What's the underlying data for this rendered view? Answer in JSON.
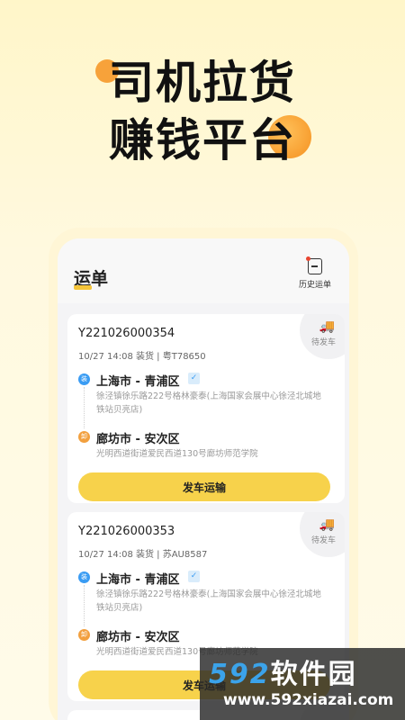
{
  "hero": {
    "line1": "司机拉货",
    "line2": "赚钱平台"
  },
  "header": {
    "title": "运单",
    "history_label": "历史运单",
    "history_icon": "document-icon"
  },
  "orders": [
    {
      "order_no": "Y221026000354",
      "meta": "10/27 14:08 装货 | 粤T78650",
      "status": "待发车",
      "load_badge": "装",
      "load_city": "上海市 - 青浦区",
      "load_address": "徐泾镇徐乐路222号格林豪泰(上海国家会展中心徐泾北城地铁站贝亮店)",
      "unload_badge": "卸",
      "unload_city": "廊坊市 - 安次区",
      "unload_address": "光明西道街道爱民西道130号廊坊师范学院",
      "action_label": "发车运输"
    },
    {
      "order_no": "Y221026000353",
      "meta": "10/27 14:08 装货 | 苏AU8587",
      "status": "待发车",
      "load_badge": "装",
      "load_city": "上海市 - 青浦区",
      "load_address": "徐泾镇徐乐路222号格林豪泰(上海国家会展中心徐泾北城地铁站贝亮店)",
      "unload_badge": "卸",
      "unload_city": "廊坊市 - 安次区",
      "unload_address": "光明西道街道爱民西道130号廊坊师范学院",
      "action_label": "发车运输"
    }
  ],
  "watermark": {
    "brand_num": "592",
    "brand_text": "软件园",
    "url": "www.592xiazai.com"
  },
  "colors": {
    "accent_yellow": "#f7d24b",
    "accent_orange": "#f59120",
    "load_blue": "#3a9cf3",
    "unload_orange": "#f2a03f"
  }
}
